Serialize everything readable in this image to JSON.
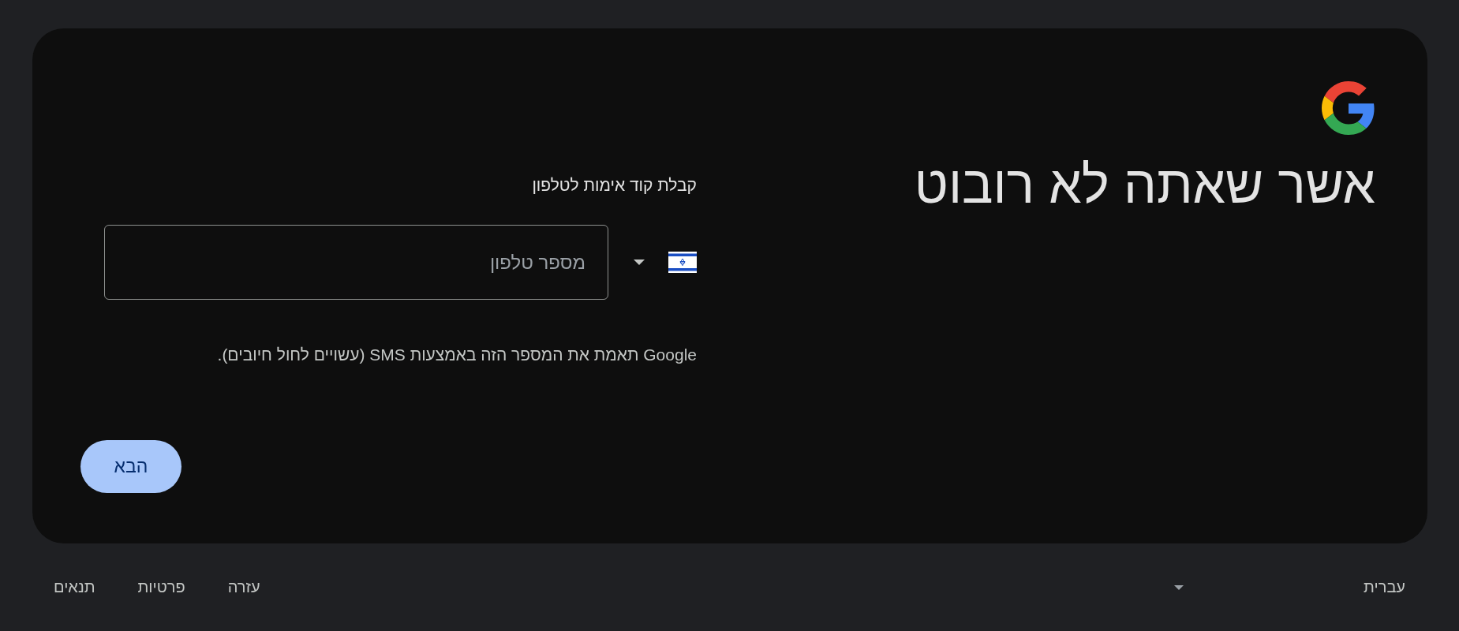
{
  "title": "אשר שאתה לא רובוט",
  "phone_section": {
    "label": "קבלת קוד אימות לטלפון",
    "phone_field": {
      "placeholder": "מספר טלפון"
    },
    "help_text": "Google תאמת את המספר הזה באמצעות SMS (עשויים לחול חיובים)."
  },
  "next_button": "הבא",
  "footer": {
    "language": "עברית",
    "links": [
      "עזרה",
      "פרטיות",
      "תנאים"
    ]
  }
}
